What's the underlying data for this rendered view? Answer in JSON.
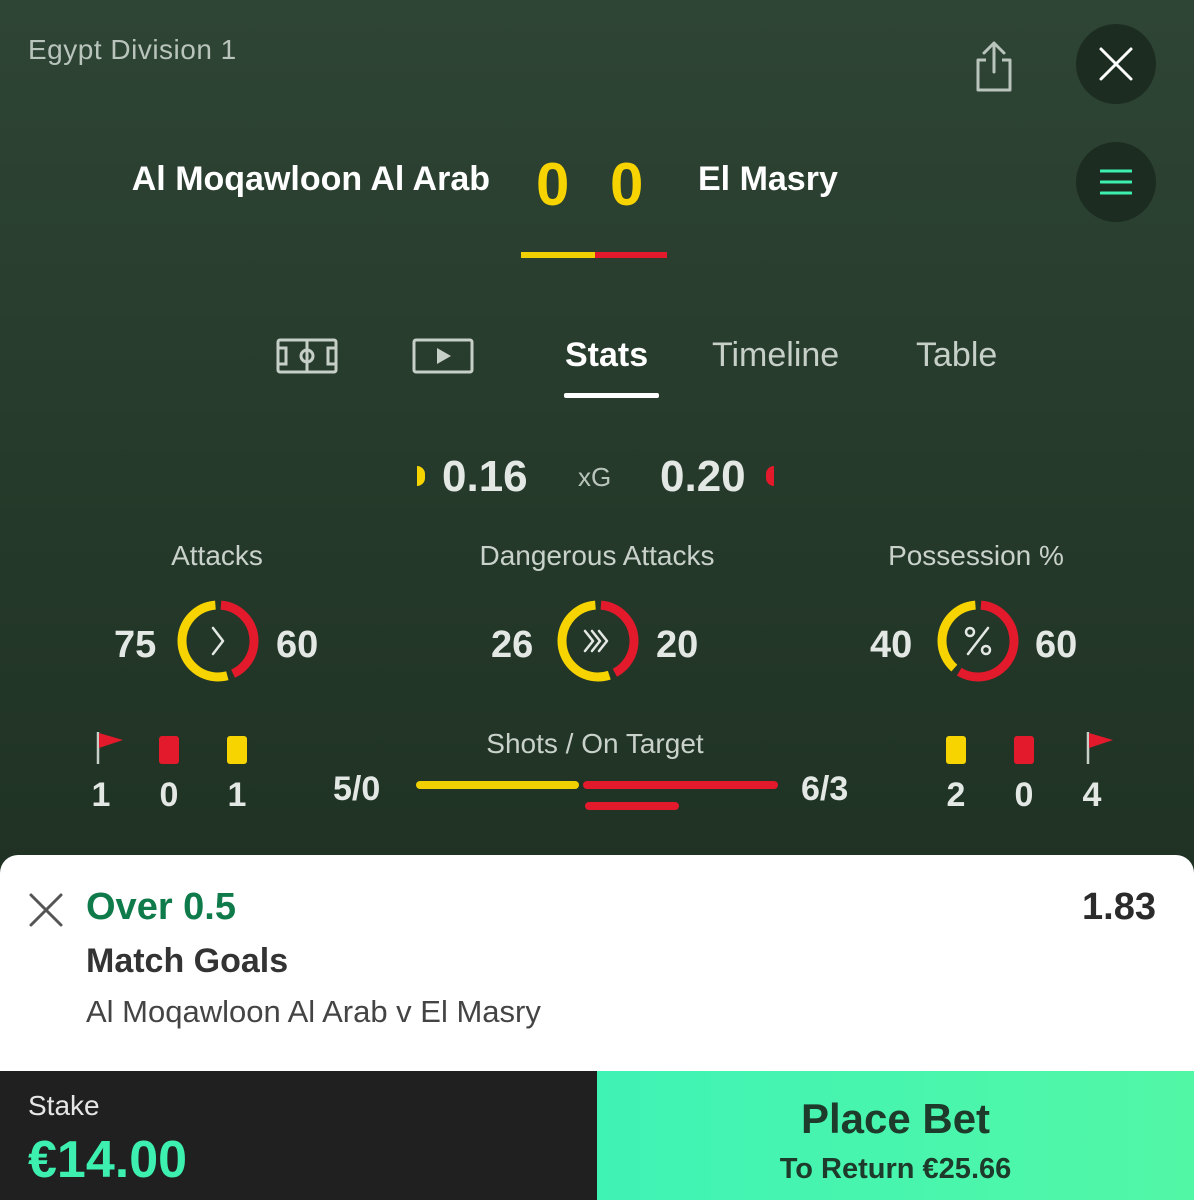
{
  "header": {
    "league": "Egypt Division 1"
  },
  "match": {
    "home_team": "Al Moqawloon Al Arab",
    "away_team": "El Masry",
    "home_score": "0",
    "away_score": "0"
  },
  "tabs": {
    "icons": [
      "pitch-icon",
      "play-icon"
    ],
    "stats": "Stats",
    "timeline": "Timeline",
    "table": "Table",
    "active": "Stats"
  },
  "xg": {
    "home": "0.16",
    "label": "xG",
    "away": "0.20"
  },
  "stats": {
    "attacks": {
      "title": "Attacks",
      "home": "75",
      "away": "60",
      "home_share": 0.556
    },
    "dangerous": {
      "title": "Dangerous Attacks",
      "home": "26",
      "away": "20",
      "home_share": 0.565
    },
    "possession": {
      "title": "Possession %",
      "home": "40",
      "away": "60",
      "home_share": 0.4
    }
  },
  "discipline": {
    "home": {
      "corners": "1",
      "red": "0",
      "yellow": "1"
    },
    "away": {
      "yellow": "2",
      "red": "0",
      "corners": "4"
    }
  },
  "shots": {
    "title": "Shots / On Target",
    "home": "5/0",
    "away": "6/3",
    "home_shots": 5,
    "away_shots": 6,
    "away_on_target": 3
  },
  "colors": {
    "home": "#f7d400",
    "away": "#e21a2c",
    "accent": "#3df0b0"
  },
  "betslip": {
    "selection": "Over 0.5",
    "odds": "1.83",
    "market": "Match Goals",
    "event": "Al Moqawloon Al Arab v El Masry",
    "stake_label": "Stake",
    "stake": "€14.00",
    "place_bet": "Place Bet",
    "to_return": "To Return €25.66"
  }
}
